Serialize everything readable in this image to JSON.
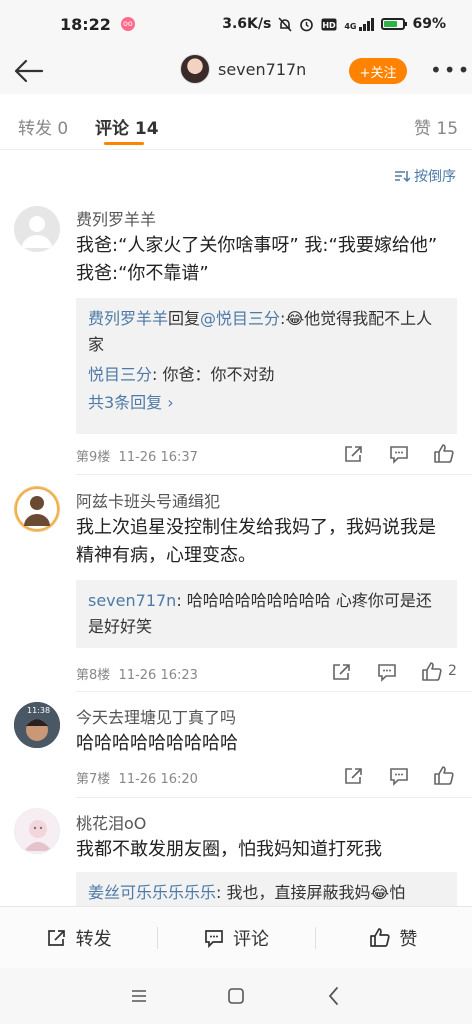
{
  "status": {
    "time": "18:22",
    "app_badge": "oo",
    "net_speed": "3.6K/s",
    "signal_label": "4G",
    "battery_level": 0.69,
    "battery_text": "69%"
  },
  "header": {
    "username": "seven717n",
    "follow_label": "+关注",
    "more_label": "•••"
  },
  "tabs": [
    {
      "label": "转发 0"
    },
    {
      "label": "评论 14"
    },
    {
      "label": "赞 15"
    }
  ],
  "sort_label": "按倒序",
  "comments": [
    {
      "name": "费列罗羊羊",
      "text": "我爸:“人家火了关你啥事呀” 我:“我要嫁给他” 我爸:“你不靠谱”",
      "replies": [
        {
          "name": "费列罗羊羊",
          "mid": "回复",
          "at": "@悦目三分",
          "text": ":😂他觉得我配不上人家"
        },
        {
          "name": "悦目三分",
          "mid": "",
          "at": "",
          "text": ": 你爸：你不对劲"
        }
      ],
      "more_replies": "共3条回复 ›",
      "floor": "第9楼",
      "time": "11-26 16:37",
      "likes": ""
    },
    {
      "name": "阿兹卡班头号通缉犯",
      "text": "我上次追星没控制住发给我妈了，我妈说我是精神有病，心理变态。",
      "replies": [
        {
          "name": "seven717n",
          "mid": "",
          "at": "",
          "text": ": 哈哈哈哈哈哈哈哈哈 心疼你可是还是好好笑"
        }
      ],
      "floor": "第8楼",
      "time": "11-26 16:23",
      "likes": "2"
    },
    {
      "name": "今天去理塘见丁真了吗",
      "text": "哈哈哈哈哈哈哈哈哈",
      "avatar_time": "11:38",
      "floor": "第7楼",
      "time": "11-26 16:20",
      "likes": ""
    },
    {
      "name": "桃花泪oO",
      "text": "我都不敢发朋友圈，怕我妈知道打死我",
      "replies": [
        {
          "name": "姜丝可乐乐乐乐乐",
          "mid": "",
          "at": "",
          "text": ": 我也，直接屏蔽我妈😂怕"
        }
      ]
    }
  ],
  "bottom": {
    "repost": "转发",
    "comment": "评论",
    "like": "赞"
  },
  "colors": {
    "accent": "#ff8200",
    "link": "#4d7aa6"
  }
}
